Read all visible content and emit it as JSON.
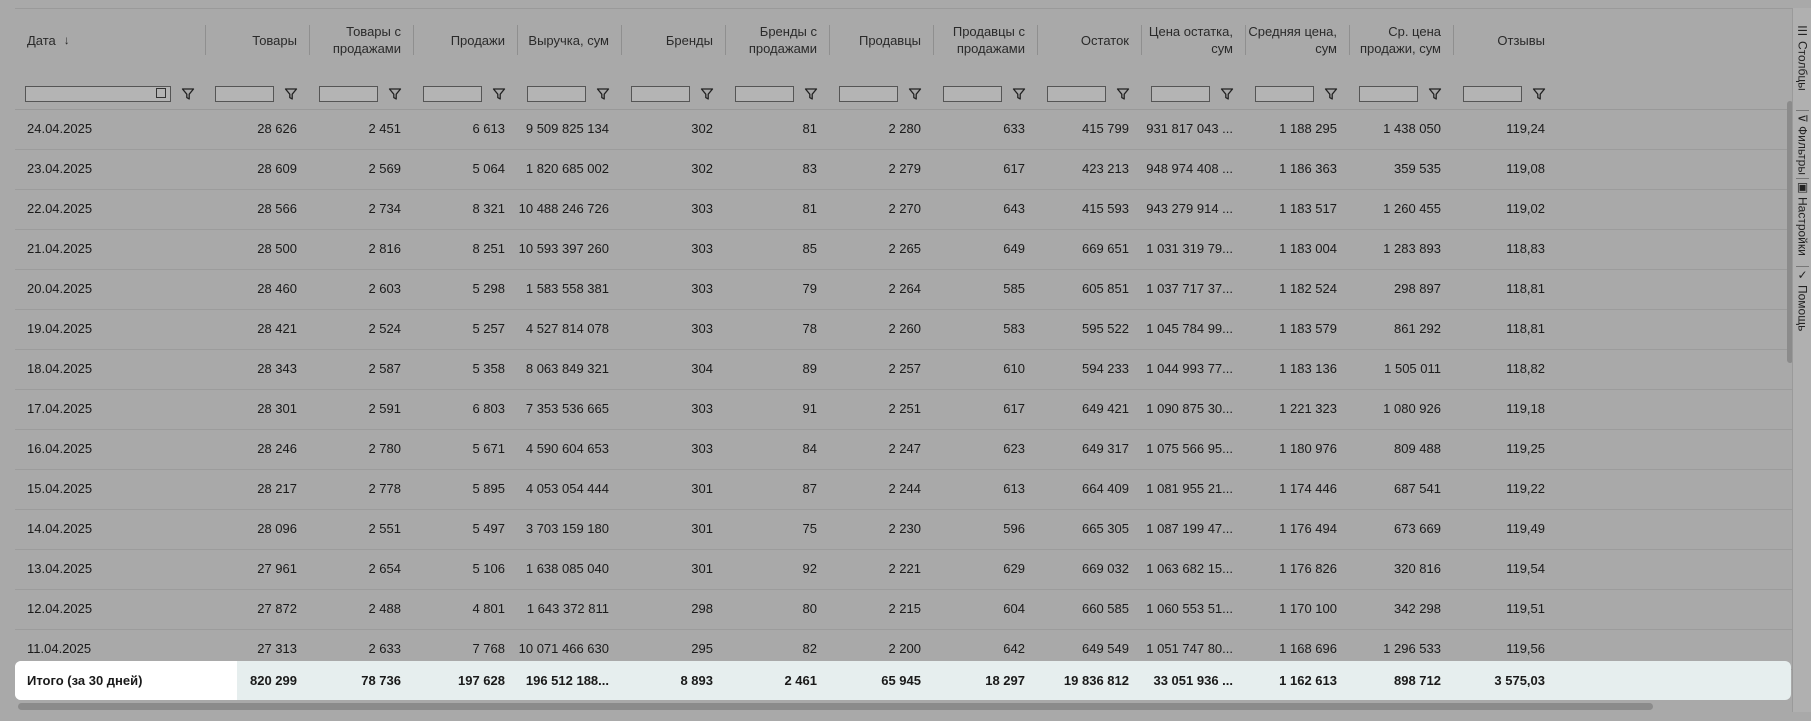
{
  "columns": [
    {
      "label": "Дата"
    },
    {
      "label": "Товары"
    },
    {
      "label": "Товары с продажами"
    },
    {
      "label": "Продажи"
    },
    {
      "label": "Выручка, сум"
    },
    {
      "label": "Бренды"
    },
    {
      "label": "Бренды с продажами"
    },
    {
      "label": "Продавцы"
    },
    {
      "label": "Продавцы с продажами"
    },
    {
      "label": "Остаток"
    },
    {
      "label": "Цена остатка, сум"
    },
    {
      "label": "Средняя цена, сум"
    },
    {
      "label": "Ср. цена продажи, сум"
    },
    {
      "label": "Отзывы"
    }
  ],
  "sort_icon": "↓",
  "rows": [
    [
      "24.04.2025",
      "28 626",
      "2 451",
      "6 613",
      "9 509 825 134",
      "302",
      "81",
      "2 280",
      "633",
      "415 799",
      "931 817 043 ...",
      "1 188 295",
      "1 438 050",
      "119,24"
    ],
    [
      "23.04.2025",
      "28 609",
      "2 569",
      "5 064",
      "1 820 685 002",
      "302",
      "83",
      "2 279",
      "617",
      "423 213",
      "948 974 408 ...",
      "1 186 363",
      "359 535",
      "119,08"
    ],
    [
      "22.04.2025",
      "28 566",
      "2 734",
      "8 321",
      "10 488 246 726",
      "303",
      "81",
      "2 270",
      "643",
      "415 593",
      "943 279 914 ...",
      "1 183 517",
      "1 260 455",
      "119,02"
    ],
    [
      "21.04.2025",
      "28 500",
      "2 816",
      "8 251",
      "10 593 397 260",
      "303",
      "85",
      "2 265",
      "649",
      "669 651",
      "1 031 319 79...",
      "1 183 004",
      "1 283 893",
      "118,83"
    ],
    [
      "20.04.2025",
      "28 460",
      "2 603",
      "5 298",
      "1 583 558 381",
      "303",
      "79",
      "2 264",
      "585",
      "605 851",
      "1 037 717 37...",
      "1 182 524",
      "298 897",
      "118,81"
    ],
    [
      "19.04.2025",
      "28 421",
      "2 524",
      "5 257",
      "4 527 814 078",
      "303",
      "78",
      "2 260",
      "583",
      "595 522",
      "1 045 784 99...",
      "1 183 579",
      "861 292",
      "118,81"
    ],
    [
      "18.04.2025",
      "28 343",
      "2 587",
      "5 358",
      "8 063 849 321",
      "304",
      "89",
      "2 257",
      "610",
      "594 233",
      "1 044 993 77...",
      "1 183 136",
      "1 505 011",
      "118,82"
    ],
    [
      "17.04.2025",
      "28 301",
      "2 591",
      "6 803",
      "7 353 536 665",
      "303",
      "91",
      "2 251",
      "617",
      "649 421",
      "1 090 875 30...",
      "1 221 323",
      "1 080 926",
      "119,18"
    ],
    [
      "16.04.2025",
      "28 246",
      "2 780",
      "5 671",
      "4 590 604 653",
      "303",
      "84",
      "2 247",
      "623",
      "649 317",
      "1 075 566 95...",
      "1 180 976",
      "809 488",
      "119,25"
    ],
    [
      "15.04.2025",
      "28 217",
      "2 778",
      "5 895",
      "4 053 054 444",
      "301",
      "87",
      "2 244",
      "613",
      "664 409",
      "1 081 955 21...",
      "1 174 446",
      "687 541",
      "119,22"
    ],
    [
      "14.04.2025",
      "28 096",
      "2 551",
      "5 497",
      "3 703 159 180",
      "301",
      "75",
      "2 230",
      "596",
      "665 305",
      "1 087 199 47...",
      "1 176 494",
      "673 669",
      "119,49"
    ],
    [
      "13.04.2025",
      "27 961",
      "2 654",
      "5 106",
      "1 638 085 040",
      "301",
      "92",
      "2 221",
      "629",
      "669 032",
      "1 063 682 15...",
      "1 176 826",
      "320 816",
      "119,54"
    ],
    [
      "12.04.2025",
      "27 872",
      "2 488",
      "4 801",
      "1 643 372 811",
      "298",
      "80",
      "2 215",
      "604",
      "660 585",
      "1 060 553 51...",
      "1 170 100",
      "342 298",
      "119,51"
    ],
    [
      "11.04.2025",
      "27 313",
      "2 633",
      "7 768",
      "10 071 466 630",
      "295",
      "82",
      "2 200",
      "642",
      "649 549",
      "1 051 747 80...",
      "1 168 696",
      "1 296 533",
      "119,56"
    ]
  ],
  "totals": [
    "Итого (за 30 дней)",
    "820 299",
    "78 736",
    "197 628",
    "196 512 188...",
    "8 893",
    "2 461",
    "65 945",
    "18 297",
    "19 836 812",
    "33 051 936 ...",
    "1 162 613",
    "898 712",
    "3 575,03"
  ],
  "side_tabs": [
    {
      "label": "Столбцы",
      "icon": "columns-icon"
    },
    {
      "label": "Фильтры",
      "icon": "filter-icon"
    },
    {
      "label": "Настройки",
      "icon": "settings-icon"
    },
    {
      "label": "Помощь",
      "icon": "help-icon"
    }
  ]
}
